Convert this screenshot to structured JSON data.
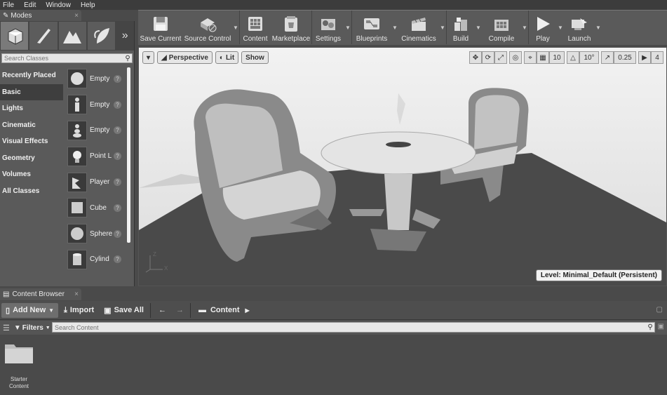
{
  "menu": [
    "File",
    "Edit",
    "Window",
    "Help"
  ],
  "modes": {
    "tab_title": "Modes",
    "search_placeholder": "Search Classes",
    "categories": [
      "Recently Placed",
      "Basic",
      "Lights",
      "Cinematic",
      "Visual Effects",
      "Geometry",
      "Volumes",
      "All Classes"
    ],
    "active_category": "Basic",
    "items": [
      "Empty",
      "Empty",
      "Empty",
      "Point L",
      "Player",
      "Cube",
      "Sphere",
      "Cylind"
    ]
  },
  "toolbar": {
    "buttons": [
      {
        "label": "Save Current",
        "icon": "save-icon"
      },
      {
        "label": "Source Control",
        "icon": "source-control-icon"
      },
      {
        "label": "Content",
        "icon": "content-icon"
      },
      {
        "label": "Marketplace",
        "icon": "marketplace-icon"
      },
      {
        "label": "Settings",
        "icon": "settings-icon"
      },
      {
        "label": "Blueprints",
        "icon": "blueprints-icon"
      },
      {
        "label": "Cinematics",
        "icon": "cinematics-icon"
      },
      {
        "label": "Build",
        "icon": "build-icon"
      },
      {
        "label": "Compile",
        "icon": "compile-icon"
      },
      {
        "label": "Play",
        "icon": "play-icon"
      },
      {
        "label": "Launch",
        "icon": "launch-icon"
      }
    ]
  },
  "viewport": {
    "perspective_label": "Perspective",
    "lit_label": "Lit",
    "show_label": "Show",
    "grid_snap": "10",
    "rotation_snap": "10°",
    "scale_snap": "0.25",
    "camera_speed": "4",
    "level_label": "Level:  Minimal_Default (Persistent)",
    "axis_z": "Z",
    "axis_x": "X"
  },
  "content_browser": {
    "tab_title": "Content Browser",
    "add_new_label": "Add New",
    "import_label": "Import",
    "save_all_label": "Save All",
    "path_label": "Content",
    "filters_label": "Filters",
    "search_placeholder": "Search Content",
    "folders": [
      "Starter Content"
    ]
  }
}
